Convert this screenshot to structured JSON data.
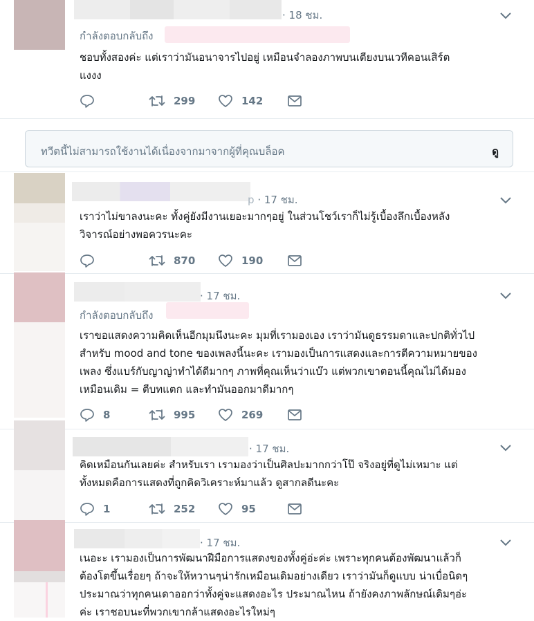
{
  "colors": {
    "text": "#14171a",
    "muted": "#657786",
    "border": "#e6ecf0",
    "blocked_bg": "#f5f8fa"
  },
  "tweets": [
    {
      "time": "· 18 ชม.",
      "reply_prefix": "กำลังตอบกลับถึง",
      "text_lines": [
        "ชอบทั้งสองค่ะ แต่เราว่ามันอนาจารไปอยู่ เหมือนจำลองภาพบนเตียงบนเวทีคอนเสิร์ต",
        "แงงง"
      ],
      "replies": "",
      "retweets": "299",
      "likes": "142"
    },
    {
      "time": "· 17 ชม.",
      "handle_fragment": "p",
      "text_lines": [
        "เราว่าไม่ขาลงนะคะ ทั้งคู่ยังมีงานเยอะมากๆอยู่ ในส่วนโชว์เราก็ไม่รู้เบื้องลึกเบื้องหลัง",
        "วิจารณ์อย่างพอควรนะคะ"
      ],
      "replies": "",
      "retweets": "870",
      "likes": "190"
    },
    {
      "time": "· 17 ชม.",
      "reply_prefix": "กำลังตอบกลับถึง",
      "text_lines": [
        "เราขอแสดงความคิดเห็นอีกมุมนึงนะคะ มุมที่เรามองเอง เราว่ามันดูธรรมดาและปกติทั่วไป",
        "สำหรับ mood and tone ของเพลงนี้นะคะ เรามองเป็นการแสดงและการตีความหมายของ",
        "เพลง ซึ่งแบร์กับญาญ่าทำได้ดีมากๆ ภาพที่คุณเห็นว่าแบ๊ว แต่พวกเขาตอนนี้คุณไม่ได้มอง",
        "เหมือนเดิม = ตีบทแตก และทำมันออกมาดีมากๆ"
      ],
      "replies": "8",
      "retweets": "995",
      "likes": "269"
    },
    {
      "time": "· 17 ชม.",
      "text_lines": [
        "คิดเหมือนกันเลยค่ะ สำหรับเรา เรามองว่าเป็นศิลปะมากกว่าโป๊ จริงอยู่ที่ดูไม่เหมาะ แต่",
        "ทั้งหมดคือการแสดงที่ถูกคิดวิเคราะห์มาแล้ว ดูสากลดีนะคะ"
      ],
      "replies": "1",
      "retweets": "252",
      "likes": "95"
    },
    {
      "time": "· 17 ชม.",
      "text_lines": [
        "เนอะะ เรามองเป็นการพัฒนาฝีมือการแสดงของทั้งคู่อ่ะค่ะ เพราะทุกคนต้องพัฒนาแล้วก็",
        "ต้องโตขึ้นเรื่อยๆ ถ้าจะให้หวานๆน่ารักเหมือนเดิมอย่างเดียว เราว่ามันก็ดูแบบ น่าเบื่อนิดๆ",
        "ประมาณว่าทุกคนเดาออกว่าทั้งคู่จะแสดงอะไร ประมาณไหน ถ้ายังคงภาพลักษณ์เดิมๆอ่ะ",
        "ค่ะ เราชอบนะที่พวกเขากล้าแสดงอะไรใหม่ๆ"
      ]
    }
  ],
  "blocked_notice": {
    "message": "ทวีตนี้ไม่สามารถใช้งานได้เนื่องจากมาจากผู้ที่คุณบล็อค",
    "view_label": "ดู"
  }
}
